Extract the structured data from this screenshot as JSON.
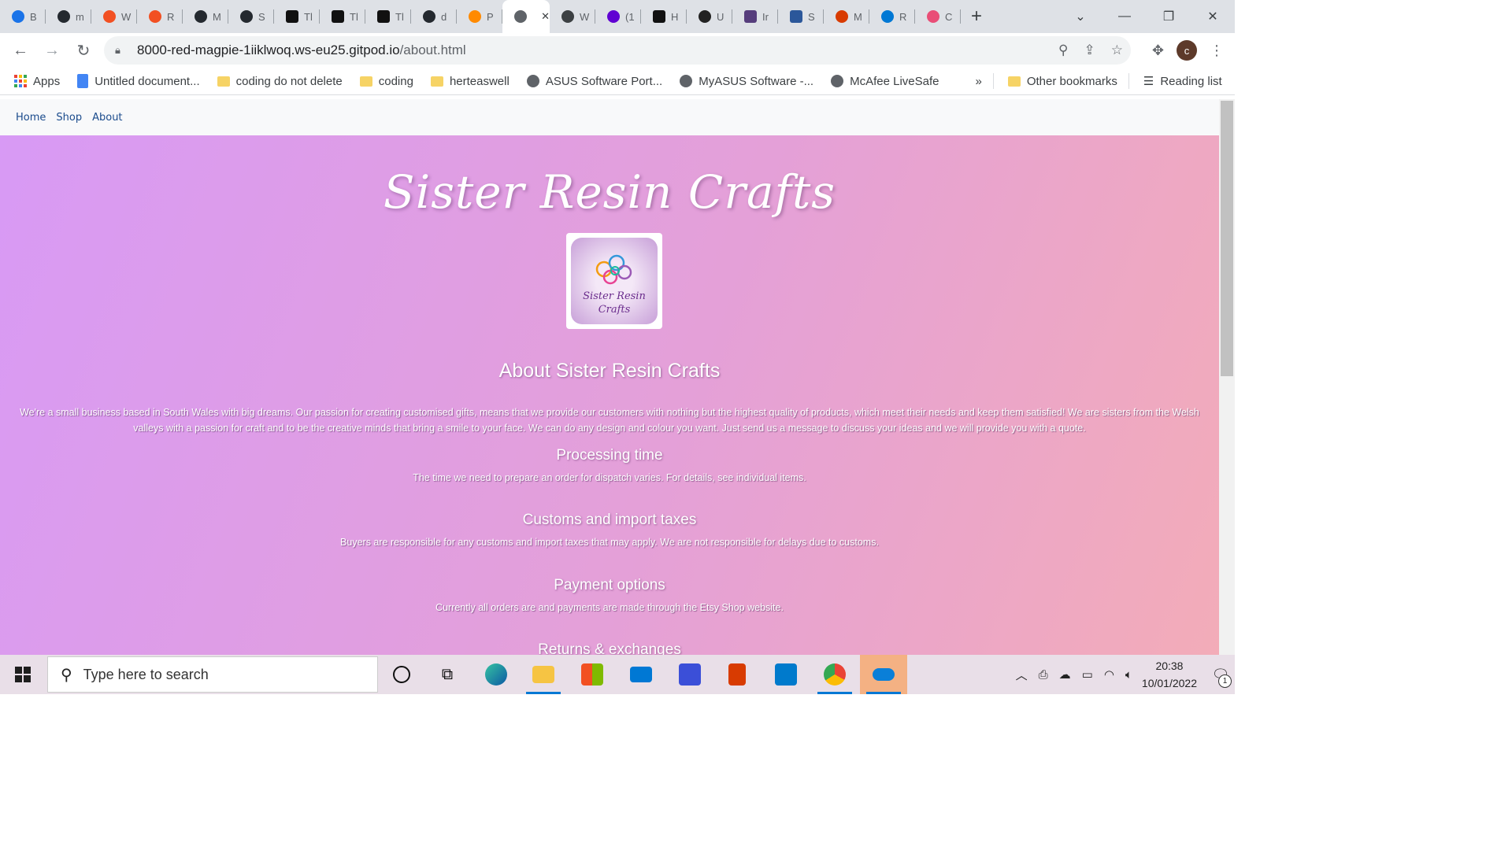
{
  "browser": {
    "tabs": [
      {
        "title": "B",
        "icon": "star-icon",
        "color": "#1a73e8"
      },
      {
        "title": "m",
        "icon": "github-icon",
        "color": "#24292f"
      },
      {
        "title": "W",
        "icon": "circle-icon",
        "color": "#f25022"
      },
      {
        "title": "R",
        "icon": "circle-icon",
        "color": "#f25022"
      },
      {
        "title": "M",
        "icon": "github-icon",
        "color": "#24292f"
      },
      {
        "title": "S",
        "icon": "github-icon",
        "color": "#24292f"
      },
      {
        "title": "Tl",
        "icon": "dark-square-icon",
        "color": "#111111"
      },
      {
        "title": "Tl",
        "icon": "dark-square-icon",
        "color": "#111111"
      },
      {
        "title": "Tl",
        "icon": "dark-square-icon",
        "color": "#111111"
      },
      {
        "title": "d",
        "icon": "github-icon",
        "color": "#24292f"
      },
      {
        "title": "P",
        "icon": "gitpod-icon",
        "color": "#ff8a00"
      },
      {
        "title": "",
        "icon": "globe-icon",
        "color": "#5f6368",
        "active": true
      },
      {
        "title": "W",
        "icon": "circle-icon",
        "color": "#3c4043"
      },
      {
        "title": "(1",
        "icon": "mail-icon",
        "color": "#6001d2"
      },
      {
        "title": "H",
        "icon": "dark-square-icon",
        "color": "#111111"
      },
      {
        "title": "U",
        "icon": "map-icon",
        "color": "#222222"
      },
      {
        "title": "Ir",
        "icon": "bootstrap-icon",
        "color": "#563d7c"
      },
      {
        "title": "S",
        "icon": "word-icon",
        "color": "#2b579a"
      },
      {
        "title": "M",
        "icon": "office-icon",
        "color": "#d83b01"
      },
      {
        "title": "R",
        "icon": "onedrive-icon",
        "color": "#0078d4"
      },
      {
        "title": "C",
        "icon": "rainbow-icon",
        "color": "#e94e77"
      }
    ],
    "url_host": "8000-red-magpie-1iiklwoq.ws-eu25.gitpod.io",
    "url_path": "/about.html",
    "avatar_letter": "c",
    "bookmarks": [
      {
        "label": "Apps",
        "icon": "apps-grid-icon"
      },
      {
        "label": "Untitled document...",
        "icon": "docs-icon"
      },
      {
        "label": "coding do not delete",
        "icon": "folder-icon"
      },
      {
        "label": "coding",
        "icon": "folder-icon"
      },
      {
        "label": "herteaswell",
        "icon": "folder-icon"
      },
      {
        "label": "ASUS Software Port...",
        "icon": "globe-icon"
      },
      {
        "label": "MyASUS Software -...",
        "icon": "globe-icon"
      },
      {
        "label": "McAfee LiveSafe",
        "icon": "globe-icon"
      }
    ],
    "bookmarks_overflow": "»",
    "other_bookmarks": "Other bookmarks",
    "reading_list": "Reading list"
  },
  "site": {
    "nav": [
      "Home",
      "Shop",
      "About"
    ],
    "brand": "Sister Resin Crafts",
    "logo_text": "Sister Resin Crafts",
    "about_heading": "About Sister Resin Crafts",
    "about_text": "We're a small business based in South Wales with big dreams. Our passion for creating customised gifts, means that we provide our customers with nothing but the highest quality of products, which meet their needs and keep them satisfied! We are sisters from the Welsh valleys with a passion for craft and to be the creative minds that bring a smile to your face. We can do any design and colour you want. Just send us a message to discuss your ideas and we will provide you with a quote.",
    "sections": [
      {
        "heading": "Processing time",
        "text": "The time we need to prepare an order for dispatch varies. For details, see individual items."
      },
      {
        "heading": "Customs and import taxes",
        "text": "Buyers are responsible for any customs and import taxes that may apply. We are not responsible for delays due to customs."
      },
      {
        "heading": "Payment options",
        "text": "Currently all orders are and payments are made through the Etsy Shop website."
      },
      {
        "heading": "Returns & exchanges",
        "text": ""
      }
    ]
  },
  "taskbar": {
    "search_placeholder": "Type here to search",
    "time": "20:38",
    "date": "10/01/2022",
    "notification_count": "1"
  },
  "colors": {
    "gradient_start": "#d89af5",
    "gradient_end": "#f3acb8",
    "nav_link": "#1a4b8c"
  }
}
